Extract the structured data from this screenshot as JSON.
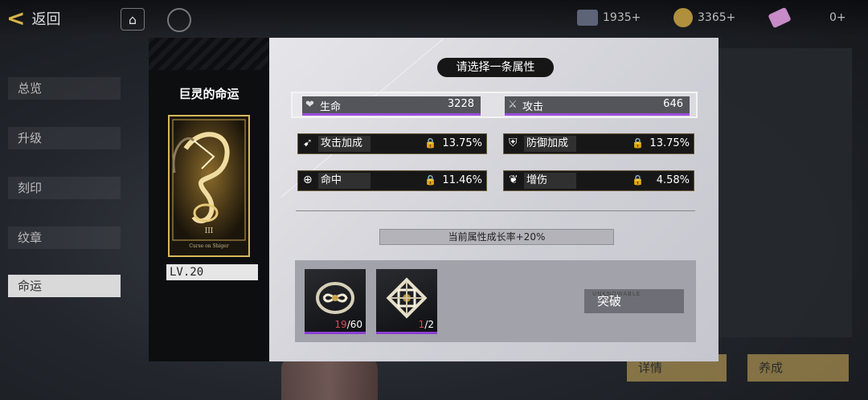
{
  "background": {
    "back_label": "返回",
    "currencies": [
      {
        "icon": "ticket-icon",
        "value": "1935+"
      },
      {
        "icon": "coin-icon",
        "value": "3365+"
      },
      {
        "icon": "gem-icon",
        "value": "0+"
      }
    ],
    "side_menu": [
      "总览",
      "升级",
      "刻印",
      "纹章",
      "命运"
    ],
    "side_menu_active": 4,
    "bottom_buttons": [
      "详情",
      "养成"
    ]
  },
  "dialog": {
    "card_name": "巨灵的命运",
    "card_numeral": "III",
    "card_caption": "Curse on Shiger",
    "level": "LV.20",
    "prompt": "请选择一条属性",
    "base_stats": [
      {
        "icon": "heart-icon",
        "name": "生命",
        "value": "3228"
      },
      {
        "icon": "sword-icon",
        "name": "攻击",
        "value": "646"
      }
    ],
    "options": [
      {
        "icon": "attack-boost-icon",
        "name": "攻击加成",
        "value": "13.75%"
      },
      {
        "icon": "defense-boost-icon",
        "name": "防御加成",
        "value": "13.75%"
      },
      {
        "icon": "crosshair-icon",
        "name": "命中",
        "value": "11.46%"
      },
      {
        "icon": "damage-boost-icon",
        "name": "增伤",
        "value": "4.58%"
      }
    ],
    "growth_text": "当前属性成长率+20%",
    "materials": [
      {
        "icon": "knot-material-icon",
        "have": "19",
        "need": "/60"
      },
      {
        "icon": "lattice-material-icon",
        "have": "1",
        "need": "/2"
      }
    ],
    "breakthrough_label": "突破",
    "breakthrough_caption": "UNKNOWABLE"
  },
  "colors": {
    "accent_purple": "#9d4be0",
    "gold": "#d9b85c",
    "insufficient_red": "#e0455a"
  }
}
